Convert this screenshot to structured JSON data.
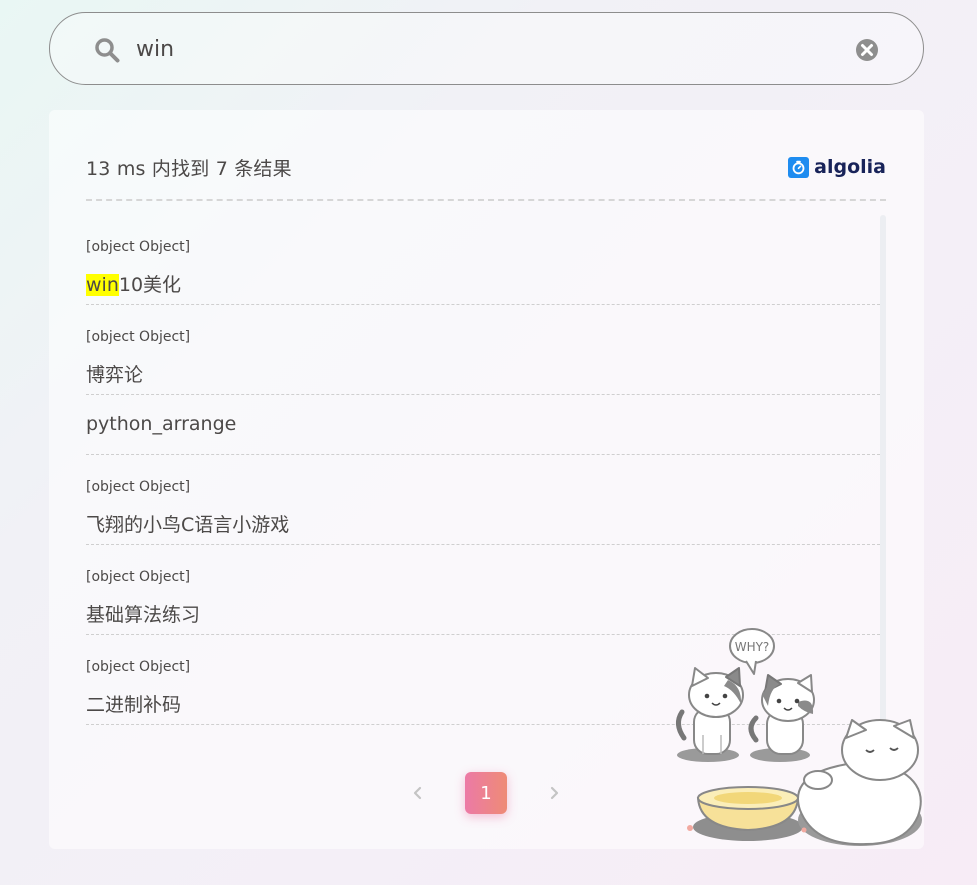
{
  "search": {
    "value": "win",
    "placeholder": ""
  },
  "results": {
    "stats": "13 ms 内找到 7 条结果",
    "provider": "algolia",
    "hits": [
      {
        "category": "[object Object]",
        "title_highlight": "win",
        "title_rest": "10美化"
      },
      {
        "category": "[object Object]",
        "title_highlight": "",
        "title_rest": "博弈论"
      },
      {
        "category": "",
        "title_highlight": "",
        "title_rest": "python_arrange"
      },
      {
        "category": "[object Object]",
        "title_highlight": "",
        "title_rest": "飞翔的小鸟C语言小游戏"
      },
      {
        "category": "[object Object]",
        "title_highlight": "",
        "title_rest": "基础算法练习"
      },
      {
        "category": "[object Object]",
        "title_highlight": "",
        "title_rest": "二进制补码"
      }
    ]
  },
  "pagination": {
    "current": "1"
  },
  "illustration": {
    "bubble_text": "WHY?"
  },
  "colors": {
    "accent_start": "#ec7aa6",
    "accent_end": "#ee8b76",
    "highlight": "#ffff00",
    "algolia_blue": "#1e8cf0"
  }
}
